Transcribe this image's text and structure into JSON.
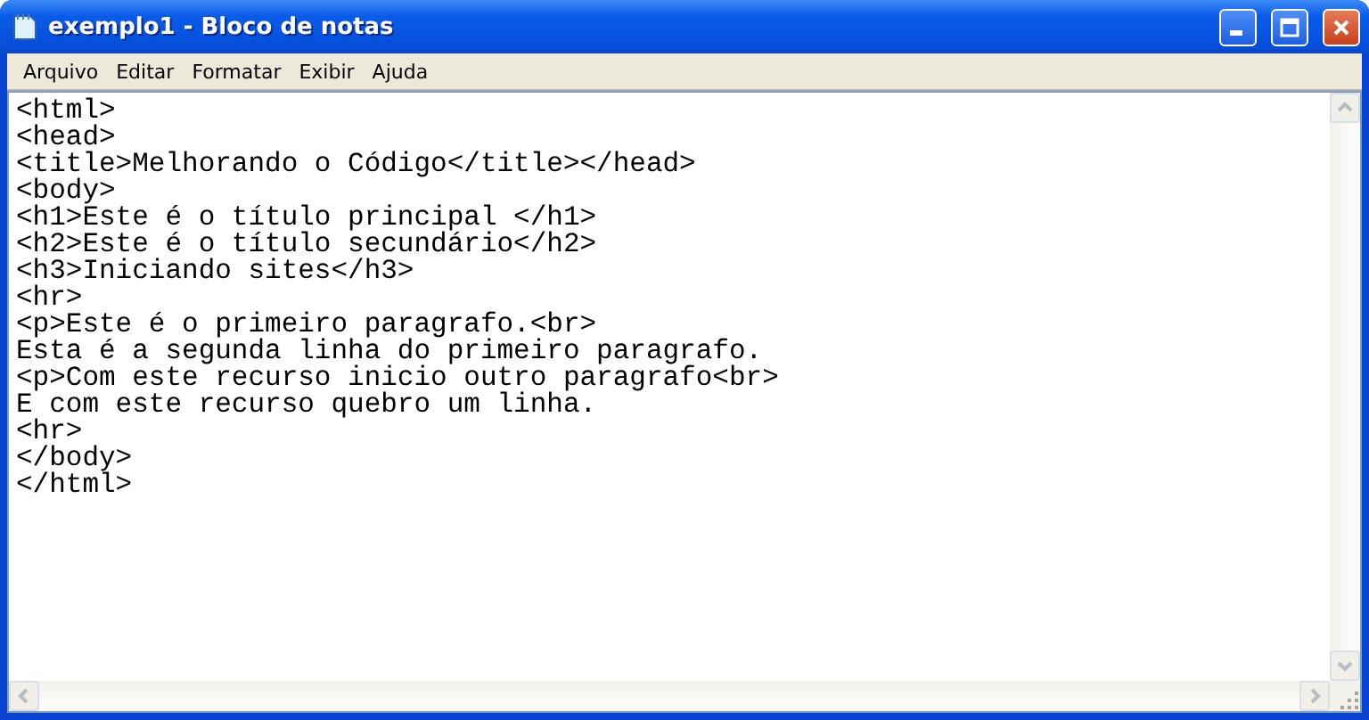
{
  "window": {
    "title": "exemplo1 - Bloco de notas"
  },
  "menu": [
    "Arquivo",
    "Editar",
    "Formatar",
    "Exibir",
    "Ajuda"
  ],
  "editor": {
    "lines": [
      "<html>",
      "<head>",
      "<title>Melhorando o Código</title></head>",
      "<body>",
      "<h1>Este é o título principal </h1>",
      "<h2>Este é o título secundário</h2>",
      "<h3>Iniciando sites</h3>",
      "<hr>",
      "<p>Este é o primeiro paragrafo.<br>",
      "Esta é a segunda linha do primeiro paragrafo.",
      "<p>Com este recurso inicio outro paragrafo<br>",
      "E com este recurso quebro um linha.",
      "<hr>",
      "</body>",
      "</html>"
    ]
  }
}
